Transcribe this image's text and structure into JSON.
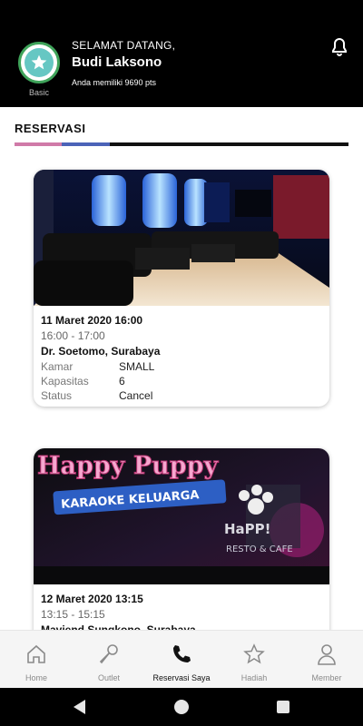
{
  "header": {
    "welcome": "SELAMAT DATANG,",
    "username": "Budi Laksono",
    "points": "Anda memiliki 9690 pts",
    "member_tier": "Basic",
    "badge_icon": "star-icon",
    "notification_icon": "bell-icon"
  },
  "section": {
    "title": "RESERVASI",
    "indicator_colors": [
      "#d07aa8",
      "#4b63b8",
      "#111111"
    ]
  },
  "reservations": [
    {
      "image": "karaoke-room-photo",
      "date": "11 Maret 2020 16:00",
      "time": "16:00 - 17:00",
      "location": "Dr. Soetomo, Surabaya",
      "fields": [
        {
          "label": "Kamar",
          "value": "SMALL"
        },
        {
          "label": "Kapasitas",
          "value": "6"
        },
        {
          "label": "Status",
          "value": "Cancel"
        }
      ]
    },
    {
      "image": "happy-puppy-banner",
      "banner_title": "Happy Puppy",
      "banner_subtitle": "KARAOKE KELUARGA",
      "date": "12 Maret 2020 13:15",
      "time": "13:15 - 15:15",
      "location": "Maviend Sungkono, Surabaya"
    }
  ],
  "bottom_nav": [
    {
      "label": "Home",
      "icon": "home-icon"
    },
    {
      "label": "Outlet",
      "icon": "microphone-icon"
    },
    {
      "label": "Reservasi Saya",
      "icon": "phone-icon",
      "active": true
    },
    {
      "label": "Hadiah",
      "icon": "star-outline-icon"
    },
    {
      "label": "Member",
      "icon": "person-icon"
    }
  ],
  "colors": {
    "header_bg": "#000000",
    "badge_ring": "#3fa35a",
    "badge_fill": "#66c7c3",
    "active_nav": "#111111",
    "inactive_nav": "#8a8a8a"
  }
}
